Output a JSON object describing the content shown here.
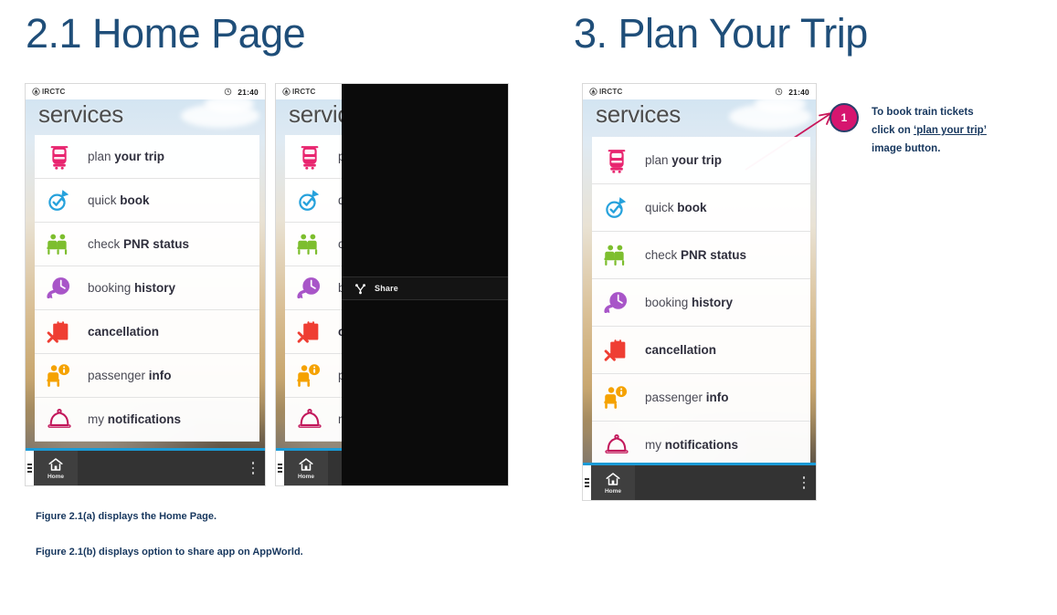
{
  "slide": {
    "headings": {
      "left": "2.1 Home Page",
      "right": "3. Plan Your Trip"
    },
    "captions": {
      "a": "Figure 2.1(a) displays the Home Page.",
      "b": "Figure 2.1(b) displays option to share app on AppWorld."
    }
  },
  "colors": {
    "heading": "#1F4E79",
    "caption": "#17375E",
    "badge_fill": "#D6156F",
    "badge_border": "#2b3f6b",
    "arrow": "#C9175A",
    "nav_accent": "#1a9ad6",
    "nav_bg": "#333333",
    "icon_train": "#E8256F",
    "icon_quickbook": "#27A2DC",
    "icon_pnr": "#7DBE2E",
    "icon_history": "#A855C8",
    "icon_cancellation": "#EF3E33",
    "icon_passenger": "#F5A200",
    "icon_notifications": "#C2185B"
  },
  "phone": {
    "statusbar": {
      "brand": "IRCTC",
      "brand_logo_icon": "irctc-logo-icon",
      "clock_icon": "clock-icon",
      "time": "21:40"
    },
    "page_title": "services",
    "navbar": {
      "home_icon": "home-icon",
      "home_label": "Home",
      "more_icon": "more-dots-icon"
    },
    "services": [
      {
        "icon": "train-icon",
        "light": "plan ",
        "bold": "your trip",
        "all_bold": false
      },
      {
        "icon": "quick-book-icon",
        "light": "quick ",
        "bold": "book",
        "all_bold": false
      },
      {
        "icon": "pnr-status-icon",
        "light": "check ",
        "bold": "PNR status",
        "all_bold": false
      },
      {
        "icon": "history-clock-icon",
        "light": "booking ",
        "bold": "history",
        "all_bold": false
      },
      {
        "icon": "cancellation-icon",
        "light": "",
        "bold": "cancellation",
        "all_bold": true
      },
      {
        "icon": "passenger-info-icon",
        "light": "passenger ",
        "bold": "info",
        "all_bold": false
      },
      {
        "icon": "notifications-icon",
        "light": "my ",
        "bold": "notifications",
        "all_bold": false
      }
    ]
  },
  "share_menu": {
    "share_icon": "share-icon",
    "share_label": "Share"
  },
  "callout": {
    "number": "1",
    "line1": "To book train tickets",
    "line2_prefix": "click on ",
    "line2_link": "‘plan your trip’",
    "line3": "image button.",
    "arrow_icon": "arrow-pointer-icon"
  }
}
